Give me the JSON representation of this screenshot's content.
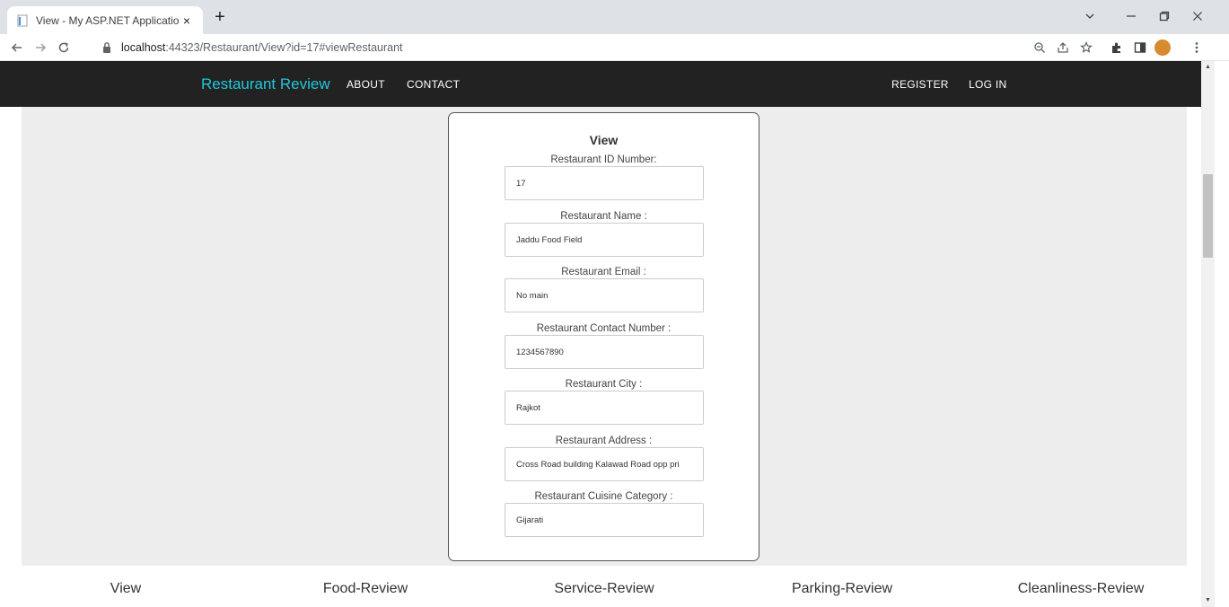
{
  "browser": {
    "tab_title": "View - My ASP.NET Application",
    "tab_close": "×",
    "new_tab": "+",
    "url_host": "localhost",
    "url_rest": ":44323/Restaurant/View?id=17#viewRestaurant"
  },
  "navbar": {
    "brand": "Restaurant Review",
    "links": [
      "ABOUT",
      "CONTACT"
    ],
    "right_links": [
      "REGISTER",
      "LOG IN"
    ]
  },
  "card": {
    "title": "View",
    "fields": [
      {
        "label": "Restaurant ID Number:",
        "value": "17"
      },
      {
        "label": "Restaurant Name :",
        "value": "Jaddu Food Field"
      },
      {
        "label": "Restaurant Email :",
        "value": "No main"
      },
      {
        "label": "Restaurant Contact Number :",
        "value": "1234567890"
      },
      {
        "label": "Restaurant City :",
        "value": "Rajkot"
      },
      {
        "label": "Restaurant Address :",
        "value": "Cross Road building Kalawad Road opp pri"
      },
      {
        "label": "Restaurant Cuisine Category :",
        "value": "Gijarati"
      }
    ]
  },
  "bottom_tabs": [
    "View",
    "Food-Review",
    "Service-Review",
    "Parking-Review",
    "Cleanliness-Review"
  ],
  "colors": {
    "brand": "#21c7d9",
    "navbar_bg": "#222222",
    "page_bg": "#ededed"
  }
}
